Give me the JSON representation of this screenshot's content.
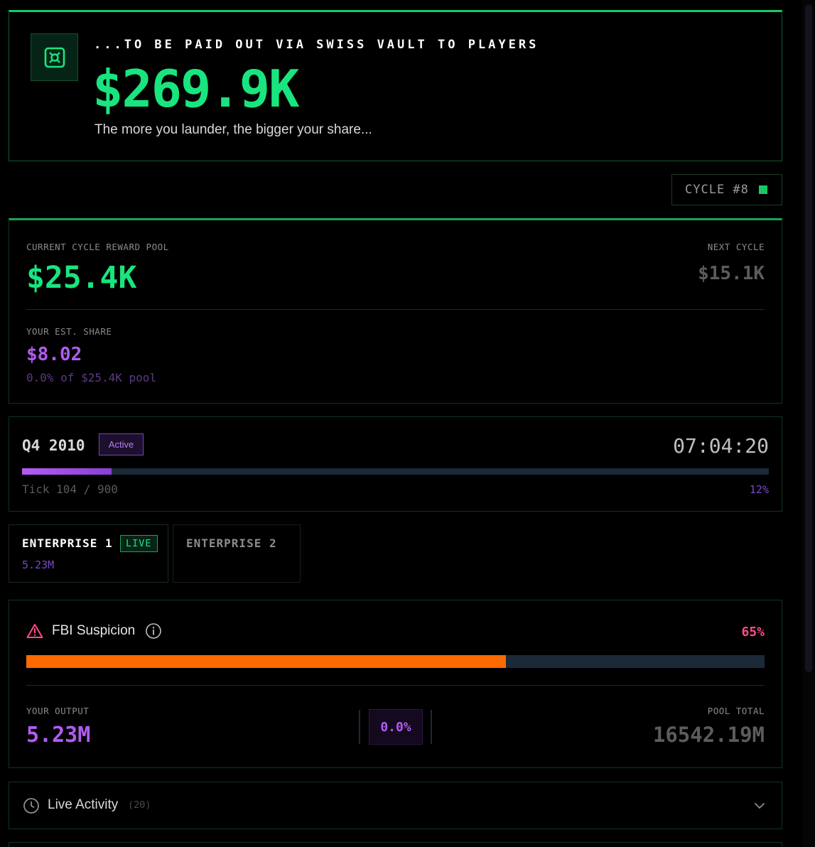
{
  "hero": {
    "kicker": "...TO BE PAID OUT VIA SWISS VAULT TO PLAYERS",
    "amount": "$269.9K",
    "tagline": "The more you launder, the bigger your share...",
    "logo_icon": "vault-icon"
  },
  "cycle": {
    "label": "CYCLE #8",
    "indicator_color": "#17c964"
  },
  "reward_pool": {
    "label": "CURRENT CYCLE REWARD POOL",
    "amount": "$25.4K",
    "next_label": "NEXT CYCLE",
    "next_amount": "$15.1K",
    "share_label": "YOUR EST. SHARE",
    "share_amount": "$8.02",
    "share_detail": "0.0% of $25.4K pool"
  },
  "quarter": {
    "label": "Q4 2010",
    "status": "Active",
    "timer": "07:04:20",
    "tick_text": "Tick 104 / 900",
    "progress_text": "12%",
    "progress": 0.12
  },
  "enterprises": [
    {
      "name": "ENTERPRISE 1",
      "badge": "LIVE",
      "value": "5.23M"
    },
    {
      "name": "ENTERPRISE 2"
    }
  ],
  "fbi": {
    "title": "FBI Suspicion",
    "percent_text": "65%",
    "level": 0.65,
    "output_label": "YOUR OUTPUT",
    "output_value": "5.23M",
    "share_text": "0.0%",
    "pool_label": "POOL TOTAL",
    "pool_value": "16542.19M"
  },
  "activity": {
    "title": "Live Activity",
    "count": "(20)"
  },
  "colors": {
    "accent_green": "#19e57f",
    "accent_purple": "#b15cf0",
    "warning_orange": "#ff6a00",
    "danger_pink": "#ff4d8d"
  }
}
